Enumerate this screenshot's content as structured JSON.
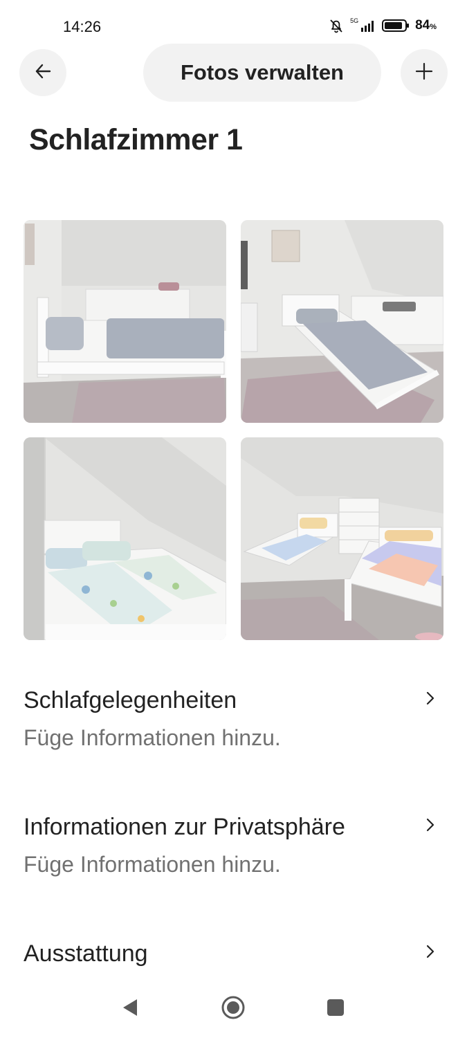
{
  "status_bar": {
    "time": "14:26",
    "network": "5G",
    "battery": "84",
    "battery_unit": "%"
  },
  "header": {
    "back_icon": "arrow-left-icon",
    "title": "Fotos verwalten",
    "add_icon": "plus-icon"
  },
  "page": {
    "title": "Schlafzimmer 1"
  },
  "photos": [
    {
      "subject": "double bed with grey floral bedding and white dresser"
    },
    {
      "subject": "single bed with grey floral bedding under sloped ceiling"
    },
    {
      "subject": "double bed with butterfly bedding"
    },
    {
      "subject": "two single beds with colorful bedding and white dresser"
    }
  ],
  "sections": [
    {
      "title": "Schlafgelegenheiten",
      "subtitle": "Füge Informationen hinzu."
    },
    {
      "title": "Informationen zur Privatsphäre",
      "subtitle": "Füge Informationen hinzu."
    },
    {
      "title": "Ausstattung"
    }
  ],
  "nav_bar": {
    "back_icon": "triangle-back-icon",
    "home_icon": "circle-home-icon",
    "recents_icon": "square-recents-icon"
  }
}
